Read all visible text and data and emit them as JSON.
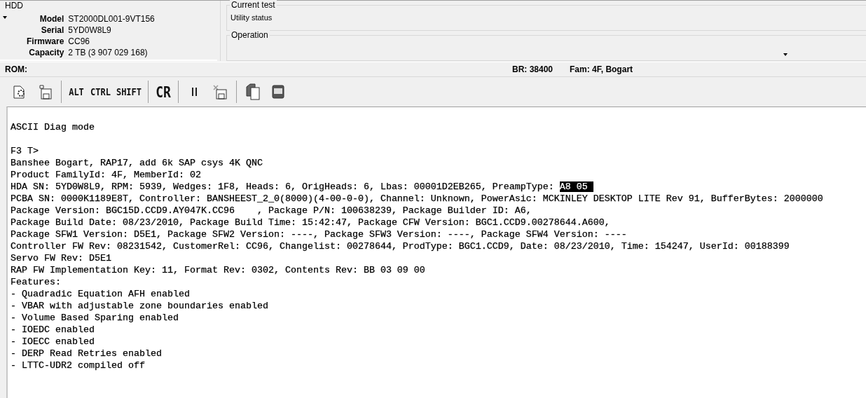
{
  "hdd": {
    "title": "HDD",
    "fields": [
      {
        "label": "Model",
        "value": "ST2000DL001-9VT156"
      },
      {
        "label": "Serial",
        "value": "5YD0W8L9"
      },
      {
        "label": "Firmware",
        "value": "CC96"
      },
      {
        "label": "Capacity",
        "value": "2 TB (3 907 029 168)"
      }
    ]
  },
  "current_test": {
    "title": "Current test",
    "value": "Utility status"
  },
  "operation": {
    "title": "Operation"
  },
  "status_bar": {
    "rom": "ROM:",
    "baud": "BR: 38400",
    "family": "Fam: 4F, Bogart"
  },
  "toolbar": [
    {
      "kind": "icon"
    },
    {
      "kind": "icon"
    },
    {
      "kind": "separator"
    },
    {
      "kind": "key",
      "label": "ALT"
    },
    {
      "kind": "key",
      "label": "CTRL"
    },
    {
      "kind": "key",
      "label": "SHIFT"
    },
    {
      "kind": "separator"
    },
    {
      "kind": "big-key",
      "label": "CR"
    },
    {
      "kind": "separator"
    },
    {
      "kind": "icon"
    },
    {
      "kind": "icon"
    },
    {
      "kind": "separator"
    },
    {
      "kind": "icon"
    },
    {
      "kind": "icon"
    }
  ],
  "terminal": {
    "blocks": [
      {
        "lines": [
          {
            "text": "ASCII Diag mode"
          }
        ]
      },
      {
        "lines": [
          {
            "text": "F3 T>"
          },
          {
            "text": "Banshee Bogart, RAP17, add 6k SAP csys 4K QNC"
          },
          {
            "text": "Product FamilyId: 4F, MemberId: 02"
          },
          {
            "text": "HDA SN: 5YD0W8L9, RPM: 5939, Wedges: 1F8, Heads: 6, OrigHeads: 6, Lbas: 00001D2EB265, PreampType: ",
            "selected_text": "A8 05 "
          },
          {
            "text": "PCBA SN: 0000K1189E8T, Controller: BANSHEEST_2_0(8000)(4-00-0-0), Channel: Unknown, PowerAsic: MCKINLEY DESKTOP LITE Rev 91, BufferBytes: 2000000"
          },
          {
            "text": "Package Version: BGC15D.CCD9.AY047K.CC96    , Package P/N: 100638239, Package Builder ID: A6,"
          },
          {
            "text": "Package Build Date: 08/23/2010, Package Build Time: 15:42:47, Package CFW Version: BGC1.CCD9.00278644.A600,"
          },
          {
            "text": "Package SFW1 Version: D5E1, Package SFW2 Version: ----, Package SFW3 Version: ----, Package SFW4 Version: ----"
          },
          {
            "text": "Controller FW Rev: 08231542, CustomerRel: CC96, Changelist: 00278644, ProdType: BGC1.CCD9, Date: 08/23/2010, Time: 154247, UserId: 00188399"
          },
          {
            "text": "Servo FW Rev: D5E1"
          },
          {
            "text": "RAP FW Implementation Key: 11, Format Rev: 0302, Contents Rev: BB 03 09 00"
          },
          {
            "text": "Features:"
          },
          {
            "text": "- Quadradic Equation AFH enabled"
          },
          {
            "text": "- VBAR with adjustable zone boundaries enabled"
          },
          {
            "text": "- Volume Based Sparing enabled"
          },
          {
            "text": "- IOEDC enabled"
          },
          {
            "text": "- IOECC enabled"
          },
          {
            "text": "- DERP Read Retries enabled"
          },
          {
            "text": "- LTTC-UDR2 compiled off"
          }
        ]
      }
    ]
  }
}
